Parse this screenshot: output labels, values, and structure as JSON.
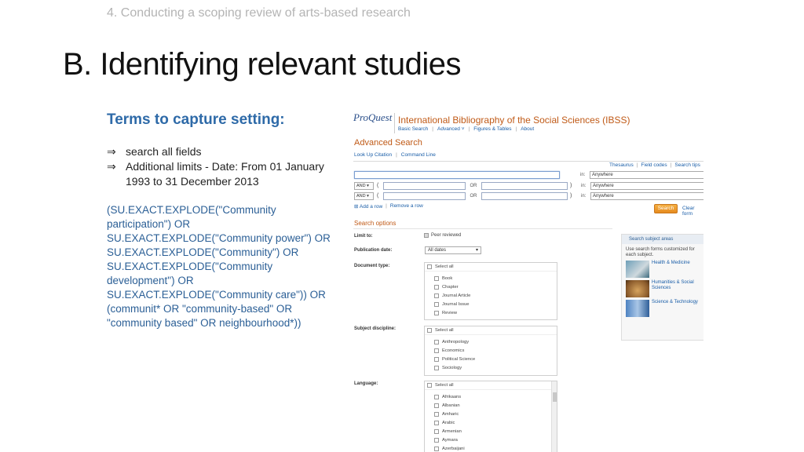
{
  "slide": {
    "header": "4. Conducting a scoping review of arts-based research",
    "title": "B. Identifying relevant studies",
    "terms_heading": "Terms to capture setting:",
    "bullets": [
      {
        "arrow": "⇒",
        "text": "search all fields"
      },
      {
        "arrow": "⇒",
        "text": "Additional limits - Date: From 01 January"
      },
      {
        "arrow": "",
        "text": "1993 to 31 December 2013"
      }
    ],
    "query_lines": [
      "(SU.EXACT.EXPLODE(\"Community",
      "participation\") OR",
      "SU.EXACT.EXPLODE(\"Community power\") OR",
      "SU.EXACT.EXPLODE(\"Community\") OR",
      "SU.EXACT.EXPLODE(\"Community",
      "development\") OR",
      "SU.EXACT.EXPLODE(\"Community care\")) OR",
      "(communit* OR \"community-based\" OR",
      "\"community based\" OR neighbourhood*))"
    ]
  },
  "proquest": {
    "logo": "ProQuest",
    "db_title": "International Bibliography of the Social Sciences (IBSS)",
    "tabs": [
      "Basic Search",
      "Advanced ˅",
      "Figures & Tables",
      "About"
    ],
    "advanced_title": "Advanced Search",
    "adv_links": [
      "Look Up Citation",
      "Command Line"
    ],
    "right_links": [
      "Thesaurus",
      "Field codes",
      "Search tips"
    ],
    "rows": [
      {
        "op": "",
        "or_label": "",
        "in": "in:",
        "field": "Anywhere"
      },
      {
        "op": "AND ▾",
        "or_label": "OR",
        "in": "in:",
        "field": "Anywhere"
      },
      {
        "op": "AND ▾",
        "or_label": "OR",
        "in": "in:",
        "field": "Anywhere"
      }
    ],
    "paren_open": "(",
    "paren_close": ")",
    "add_row": "⊞ Add a row",
    "remove_row": "Remove a row",
    "search_button": "Search",
    "clear_form": "Clear form",
    "search_options_title": "Search options",
    "limit_to_label": "Limit to:",
    "peer_reviewed": "Peer reviewed",
    "publication_date_label": "Publication date:",
    "publication_date_value": "All dates",
    "document_type_label": "Document type:",
    "document_types": [
      "Select all",
      "Book",
      "Chapter",
      "Journal Article",
      "Journal Issue",
      "Review"
    ],
    "subject_discipline_label": "Subject discipline:",
    "subject_disciplines": [
      "Select all",
      "Anthropology",
      "Economics",
      "Political Science",
      "Sociology"
    ],
    "language_label": "Language:",
    "languages": [
      "Select all",
      "Afrikaans",
      "Albanian",
      "Amharic",
      "Arabic",
      "Armenian",
      "Aymara",
      "Azerbaijani"
    ],
    "subject_panel": {
      "header": "Search subject areas",
      "intro": "Use search forms customized for each subject.",
      "items": [
        "Health & Medicine",
        "Humanities & Social Sciences",
        "Science & Technology"
      ]
    }
  }
}
